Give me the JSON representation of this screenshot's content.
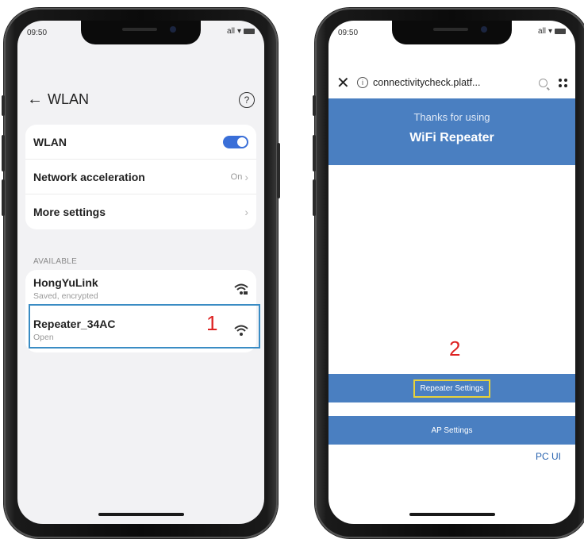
{
  "left_phone": {
    "status": {
      "time": "09:50",
      "signal": "all",
      "wifi": "▾"
    },
    "header": {
      "back_icon": "←",
      "title": "WLAN",
      "help_icon": "?"
    },
    "settings": [
      {
        "label": "WLAN",
        "toggle_on": true
      },
      {
        "label": "Network acceleration",
        "value": "On",
        "chevron": "›"
      },
      {
        "label": "More settings",
        "chevron": "›"
      }
    ],
    "available_label": "AVAILABLE",
    "networks": [
      {
        "name": "HongYuLink",
        "status": "Saved, encrypted",
        "icon": "wifi-locked-icon"
      },
      {
        "name": "Repeater_34AC",
        "status": "Open",
        "icon": "wifi-icon"
      }
    ],
    "annotation": "1",
    "highlight_color": "#3a8cc4"
  },
  "right_phone": {
    "status": {
      "time": "09:50",
      "signal": "all",
      "wifi": "▾"
    },
    "browser": {
      "close_icon": "✕",
      "info_icon": "i",
      "url": "connectivitycheck.platf..."
    },
    "banner": {
      "line1": "Thanks for using",
      "line2": "WiFi Repeater",
      "color": "#4a7fc1"
    },
    "annotation": "2",
    "buttons": {
      "repeater_settings": "Repeater Settings",
      "ap_settings": "AP Settings"
    },
    "pc_ui": "PC UI",
    "highlight_color": "#e8d23a"
  }
}
